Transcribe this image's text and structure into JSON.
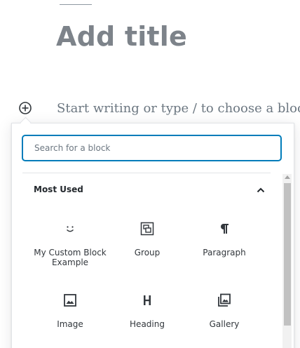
{
  "editor": {
    "title": "Add title",
    "placeholder": "Start writing or type / to choose a block"
  },
  "inserter": {
    "search": {
      "placeholder": "Search for a block",
      "value": ""
    },
    "panel": {
      "title": "Most Used",
      "expanded": true
    },
    "blocks": [
      {
        "label": "My Custom Block Example",
        "icon": "smiley-icon"
      },
      {
        "label": "Group",
        "icon": "group-icon"
      },
      {
        "label": "Paragraph",
        "icon": "paragraph-icon"
      },
      {
        "label": "Image",
        "icon": "image-icon"
      },
      {
        "label": "Heading",
        "icon": "heading-icon"
      },
      {
        "label": "Gallery",
        "icon": "gallery-icon"
      }
    ]
  },
  "colors": {
    "accent": "#007cba",
    "title": "#7d838a",
    "placeholder": "#6c7781",
    "icon": "#32373c"
  }
}
